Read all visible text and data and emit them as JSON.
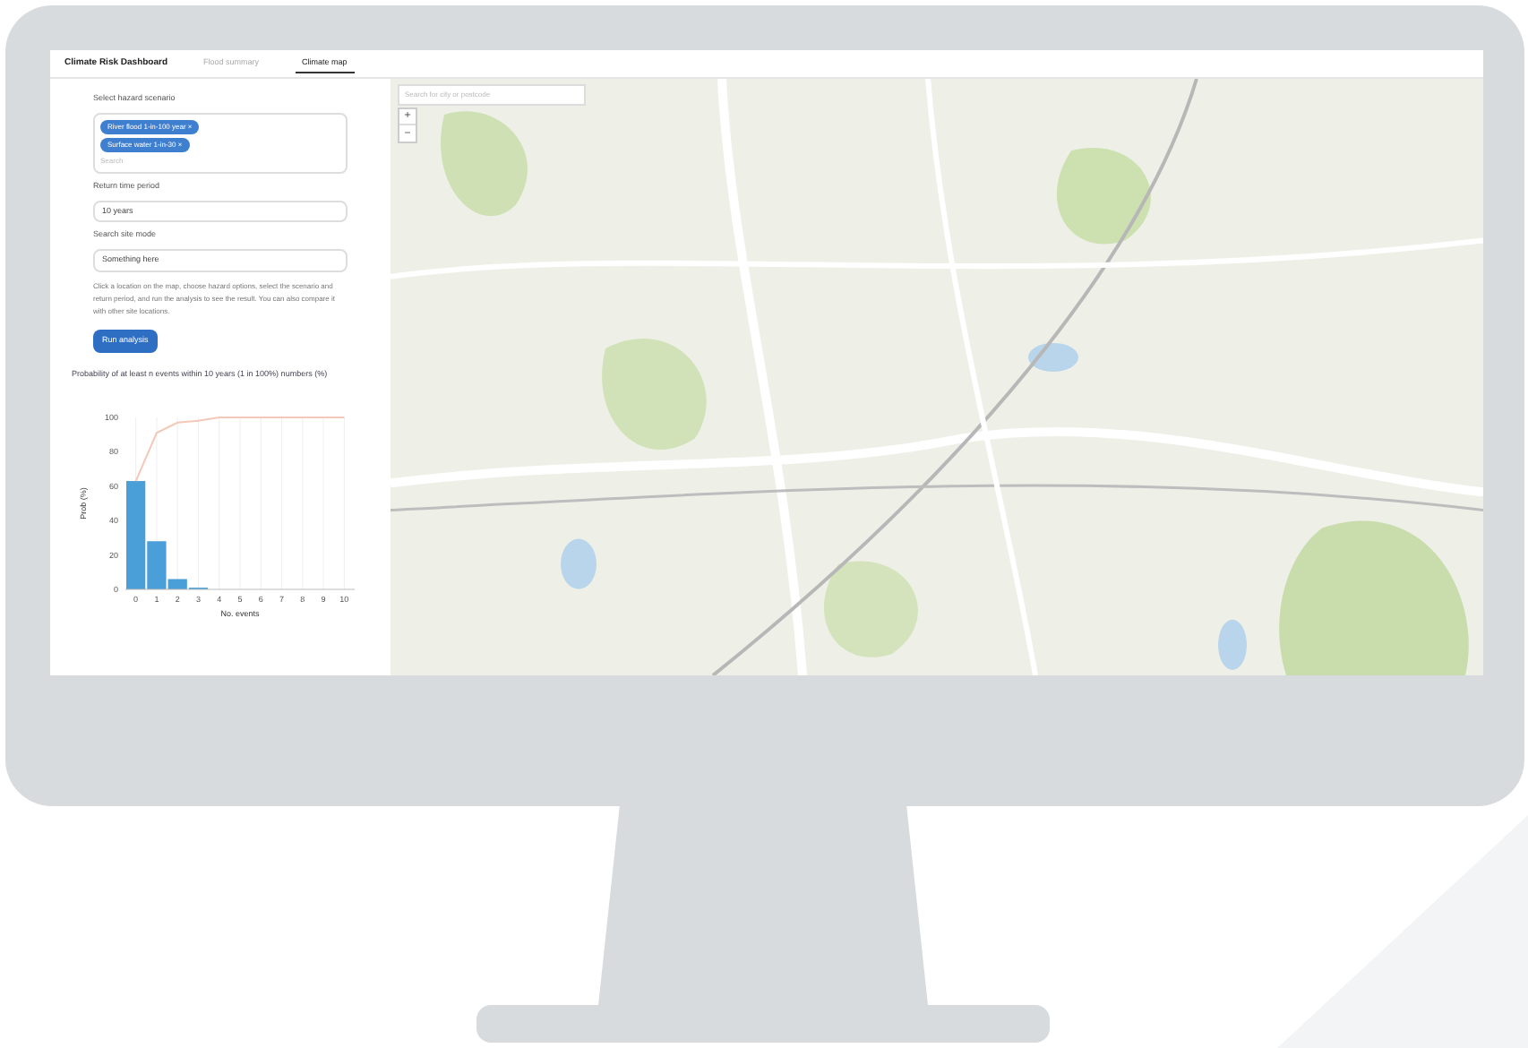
{
  "app": {
    "title": "Climate Risk Dashboard"
  },
  "tabs": [
    {
      "label": "Flood summary",
      "selected": false
    },
    {
      "label": "Climate map",
      "selected": true
    }
  ],
  "sidebar": {
    "scenario_label": "Select hazard scenario",
    "scenario_tags": [
      "River flood 1-in-100 year ×",
      "Surface water 1-in-30 ×"
    ],
    "scenario_placeholder": "Search",
    "period_label": "Return time period",
    "period_value": "10 years",
    "mode_label": "Search site mode",
    "mode_value": "Something here",
    "description": "Click a location on the map, choose hazard options, select the scenario and return period, and run the analysis to see the result. You can also compare it with other site locations.",
    "run_button": "Run analysis"
  },
  "chart_title": "Probability of at least n events within 10 years (1 in 100%) numbers (%)",
  "chart_data": {
    "type": "bar",
    "xlabel": "No. events",
    "ylabel": "Prob (%)",
    "categories": [
      "0",
      "1",
      "2",
      "3",
      "4",
      "5",
      "6",
      "7",
      "8",
      "9",
      "10"
    ],
    "grid": true,
    "series": [
      {
        "color": "#4a9fd8",
        "values": [
          63,
          28,
          6,
          1,
          0,
          0,
          0,
          0,
          0,
          0,
          0
        ]
      },
      {
        "type": "line",
        "color": "#f4c8b8",
        "values": [
          63,
          91,
          97,
          98,
          100,
          100,
          100,
          100,
          100,
          100,
          100
        ]
      }
    ],
    "ylim": [
      0,
      100
    ],
    "yticks": [
      0,
      20,
      40,
      60,
      80,
      100
    ]
  },
  "map": {
    "search_placeholder": "Search for city or postcode",
    "zoom_in": "+",
    "zoom_out": "−"
  }
}
